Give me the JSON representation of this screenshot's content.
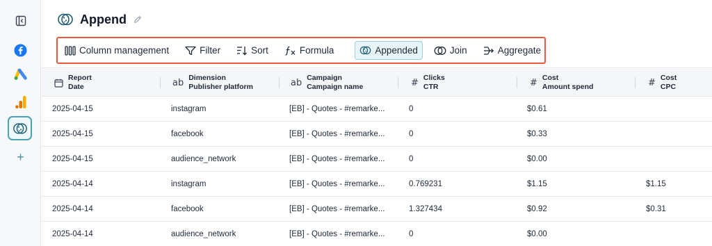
{
  "sidebar": {
    "items": [
      {
        "name": "collapse-sidebar-icon"
      },
      {
        "name": "facebook-icon",
        "color": "#1877f2"
      },
      {
        "name": "google-ads-icon"
      },
      {
        "name": "google-analytics-icon"
      },
      {
        "name": "append-icon"
      },
      {
        "name": "add-icon",
        "label": "+"
      }
    ]
  },
  "header": {
    "title": "Append"
  },
  "toolbar": {
    "column_management": "Column management",
    "filter": "Filter",
    "sort": "Sort",
    "formula": "Formula",
    "appended": "Appended",
    "join": "Join",
    "aggregate": "Aggregate"
  },
  "table": {
    "columns": [
      {
        "type": "date",
        "line1": "Report",
        "line2": "Date"
      },
      {
        "type": "ab",
        "line1": "Dimension",
        "line2": "Publisher platform"
      },
      {
        "type": "ab",
        "line1": "Campaign",
        "line2": "Campaign name"
      },
      {
        "type": "#",
        "line1": "Clicks",
        "line2": "CTR"
      },
      {
        "type": "#",
        "line1": "Cost",
        "line2": "Amount spend"
      },
      {
        "type": "#",
        "line1": "Cost",
        "line2": "CPC"
      }
    ],
    "rows": [
      [
        "2025-04-15",
        "instagram",
        "[EB] - Quotes - #remarke...",
        "0",
        "$0.61",
        ""
      ],
      [
        "2025-04-15",
        "facebook",
        "[EB] - Quotes - #remarke...",
        "0",
        "$0.33",
        ""
      ],
      [
        "2025-04-15",
        "audience_network",
        "[EB] - Quotes - #remarke...",
        "0",
        "$0.00",
        ""
      ],
      [
        "2025-04-14",
        "instagram",
        "[EB] - Quotes - #remarke...",
        "0.769231",
        "$1.15",
        "$1.15"
      ],
      [
        "2025-04-14",
        "facebook",
        "[EB] - Quotes - #remarke...",
        "1.327434",
        "$0.92",
        "$0.31"
      ],
      [
        "2025-04-14",
        "audience_network",
        "[EB] - Quotes - #remarke...",
        "0",
        "$0.00",
        ""
      ]
    ]
  }
}
